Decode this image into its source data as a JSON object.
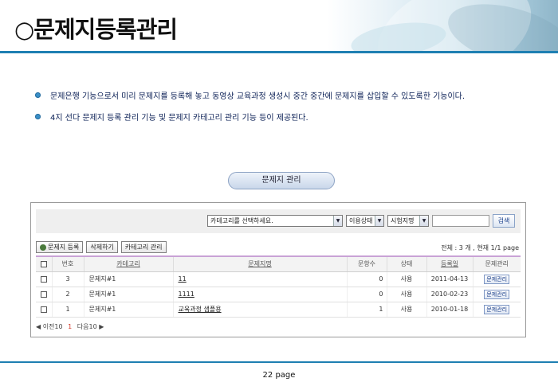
{
  "header": {
    "title": "○문제지등록관리"
  },
  "bullets": [
    "문제은행 기능으로서 미리 문제지를 등록해 놓고 동영상 교육과정 생성시 중간 중간에 문제지를 삽입할 수 있도록한 기능이다.",
    "4지 선다 문제지 등록 관리 기능 및 문제지 카테고리 관리 기능 등이 제공된다."
  ],
  "section": {
    "label": "문제지 관리"
  },
  "search": {
    "category_select": "카테고리를 선택하세요.",
    "status_select": "이용상태",
    "field_select": "시험지명",
    "search_input_value": "",
    "search_button": "검색"
  },
  "toolbar": {
    "register": "문제지 등록",
    "delete": "삭제하기",
    "category_manage": "카테고리 관리",
    "count_text": "전체 : 3 개  , 현재 1/1 page"
  },
  "table": {
    "headers": [
      "번호",
      "카테고리",
      "문제지명",
      "문항수",
      "상태",
      "등록일",
      "문제관리"
    ],
    "rows": [
      {
        "no": "3",
        "category": "문제지#1",
        "name": "11",
        "count": "0",
        "status": "사용",
        "date": "2011-04-13",
        "action": "문제관리"
      },
      {
        "no": "2",
        "category": "문제지#1",
        "name": "1111",
        "count": "0",
        "status": "사용",
        "date": "2010-02-23",
        "action": "문제관리"
      },
      {
        "no": "1",
        "category": "문제지#1",
        "name": "교육과정 샘플용",
        "count": "1",
        "status": "사용",
        "date": "2010-01-18",
        "action": "문제관리"
      }
    ]
  },
  "pager": {
    "prev": "◀ 이전10",
    "current": "1",
    "next": "다음10 ▶"
  },
  "footer": {
    "page": "22 page"
  },
  "colors": {
    "accent_blue": "#1e7fb2",
    "bullet_text": "#0a1f55",
    "pager_current": "#d63a2a"
  }
}
